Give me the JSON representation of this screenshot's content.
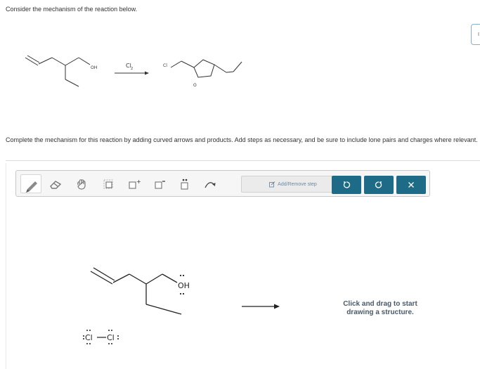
{
  "question": {
    "prompt": "Consider the mechanism of the reaction below.",
    "instructions": "Complete the mechanism for this reaction by adding curved arrows and products. Add steps as necessary, and be sure to include lone pairs and charges where relevant.",
    "side_tab": "I"
  },
  "reaction": {
    "reactant_label": "OH",
    "reagent": "Cl",
    "reagent_subscript": "2",
    "product_label_cl": "Cl",
    "product_label_o": "O"
  },
  "toolbar": {
    "add_remove_step_label": "Add/Remove step",
    "tools": [
      "pencil-icon",
      "eraser-icon",
      "hand-icon",
      "select-icon",
      "positive-charge-icon",
      "negative-charge-icon",
      "lone-pair-icon",
      "curved-arrow-icon"
    ],
    "actions": [
      "undo",
      "redo",
      "clear"
    ]
  },
  "drawing": {
    "oh_label": "OH",
    "cl_left": "Cl",
    "cl_right": "Cl"
  },
  "hint": {
    "text": "Click and drag to start drawing a structure."
  },
  "colors": {
    "accent": "#1d6b87",
    "toolbar_bg": "#f6f6f6",
    "hint_text": "#4a5a6a"
  }
}
